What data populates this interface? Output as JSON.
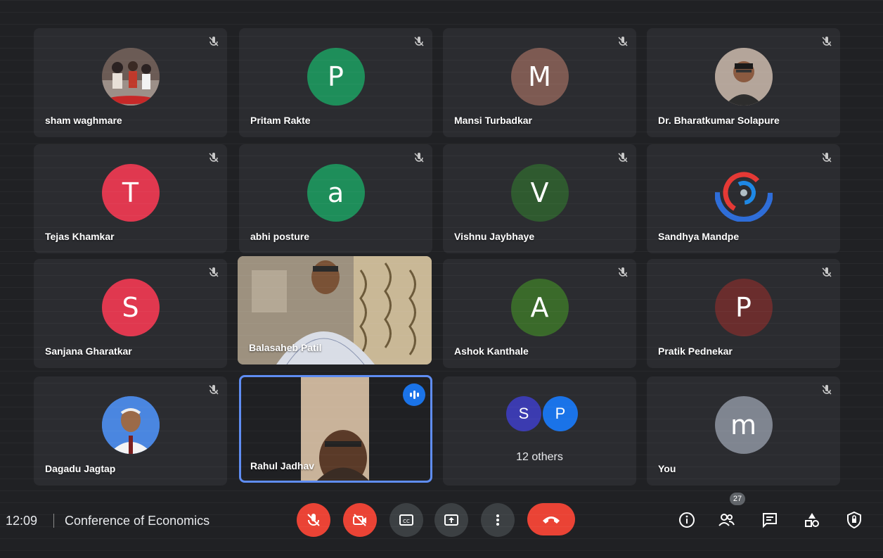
{
  "meeting": {
    "time": "12:09",
    "title": "Conference of Economics",
    "participant_count": "27"
  },
  "participants": [
    {
      "name": "sham waghmare",
      "initial": "",
      "color": "#5a4a4a",
      "muted": true
    },
    {
      "name": "Pritam Rakte",
      "initial": "P",
      "color": "#1e8e5a",
      "muted": true
    },
    {
      "name": "Mansi Turbadkar",
      "initial": "M",
      "color": "#7d5a52",
      "muted": true
    },
    {
      "name": "Dr. Bharatkumar Solapure",
      "initial": "",
      "color": "#8a7a70",
      "muted": true
    },
    {
      "name": "Tejas Khamkar",
      "initial": "T",
      "color": "#e0384f",
      "muted": true
    },
    {
      "name": "abhi posture",
      "initial": "a",
      "color": "#1e8e5a",
      "muted": true
    },
    {
      "name": "Vishnu Jaybhaye",
      "initial": "V",
      "color": "#2f5a2f",
      "muted": true
    },
    {
      "name": "Sandhya Mandpe",
      "initial": "",
      "color": "#2b2c30",
      "muted": true
    },
    {
      "name": "Sanjana Gharatkar",
      "initial": "S",
      "color": "#e0384f",
      "muted": true
    },
    {
      "name": "Balasaheb Patil",
      "initial": "",
      "color": "",
      "muted": false
    },
    {
      "name": "Ashok Kanthale",
      "initial": "A",
      "color": "#3a6a2a",
      "muted": true
    },
    {
      "name": "Pratik Pednekar",
      "initial": "P",
      "color": "#6a2d2d",
      "muted": true
    },
    {
      "name": "Dagadu Jagtap",
      "initial": "",
      "color": "#3f7ad6",
      "muted": true
    },
    {
      "name": "Rahul Jadhav",
      "initial": "",
      "color": "",
      "muted": false
    },
    {
      "name": "",
      "initial": "",
      "color": "",
      "muted": false
    },
    {
      "name": "You",
      "initial": "m",
      "color": "#7f8590",
      "muted": true
    }
  ],
  "others": {
    "label": "12 others",
    "avatars": [
      {
        "initial": "S",
        "color": "#3b3bb0"
      },
      {
        "initial": "P",
        "color": "#1a73e8"
      }
    ]
  },
  "icons": {
    "mic": "mic-off-icon",
    "camera": "camera-off-icon",
    "captions": "captions-icon",
    "present": "present-icon",
    "more": "more-options-icon",
    "hangup": "hangup-icon",
    "info": "info-icon",
    "people": "people-icon",
    "chat": "chat-icon",
    "activities": "activities-icon",
    "host": "host-controls-icon"
  },
  "colors": {
    "accent": "#1a73e8",
    "danger": "#ea4335",
    "background": "#202124"
  }
}
